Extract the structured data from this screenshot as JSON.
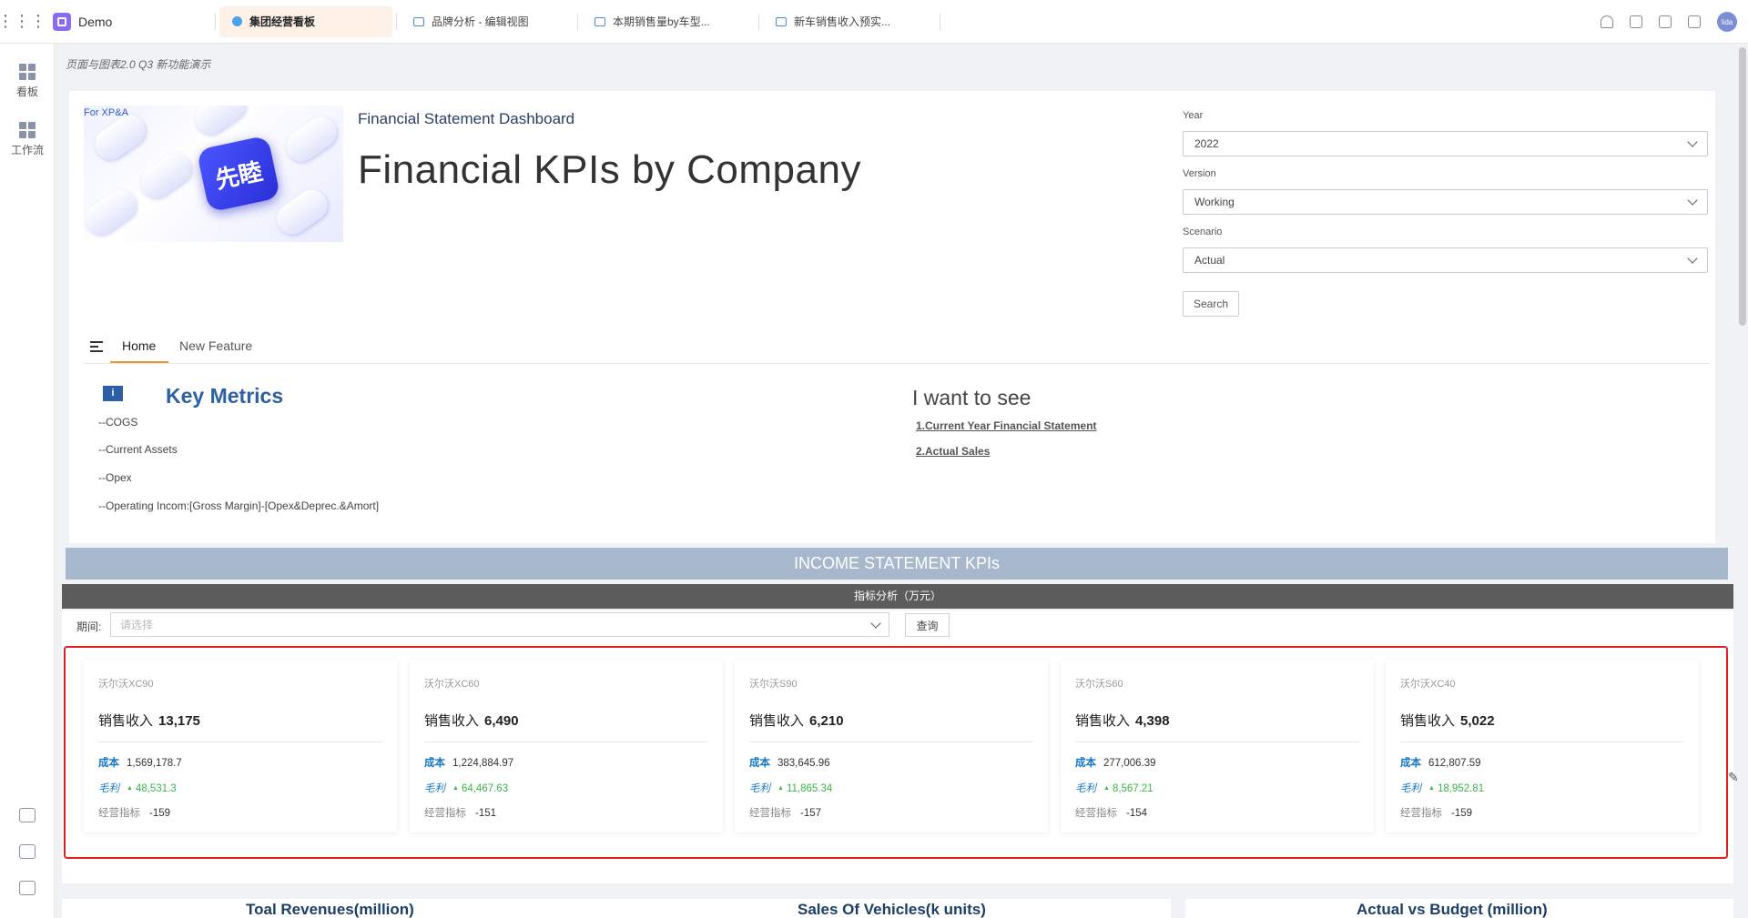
{
  "app": {
    "name": "Demo"
  },
  "tabs": [
    {
      "label": "集团经营看板",
      "active": true
    },
    {
      "label": "品牌分析 - 编辑视图",
      "active": false
    },
    {
      "label": "本期销售量by车型...",
      "active": false
    },
    {
      "label": "新车销售收入预实...",
      "active": false
    }
  ],
  "user": {
    "avatar_text": "lida"
  },
  "sidebar": {
    "items": [
      {
        "label": "看板",
        "icon": "dashboard-icon"
      },
      {
        "label": "工作流",
        "icon": "workflow-icon"
      }
    ]
  },
  "page": {
    "note": "页面与图表2.0 Q3 新功能演示",
    "hero_tag": "For XP&A",
    "hero_badge": "先睦",
    "subtitle": "Financial Statement Dashboard",
    "title": "Financial KPIs by Company"
  },
  "filters": {
    "year_label": "Year",
    "year_value": "2022",
    "version_label": "Version",
    "version_value": "Working",
    "scenario_label": "Scenario",
    "scenario_value": "Actual",
    "search_label": "Search"
  },
  "nav": {
    "home": "Home",
    "new_feature": "New Feature"
  },
  "key_metrics": {
    "icon_text": "i",
    "title": "Key Metrics",
    "items": [
      "--COGS",
      "--Current Assets",
      "--Opex",
      "--Operating Incom:[Gross Margin]-[Opex&Deprec.&Amort]"
    ]
  },
  "want": {
    "title": "I want to see",
    "links": [
      "1.Current Year Financial Statement",
      "2.Actual Sales"
    ]
  },
  "banners": {
    "income": "INCOME STATEMENT KPIs",
    "metric": "指标分析（万元）"
  },
  "period": {
    "label": "期间:",
    "placeholder": "请选择",
    "query": "查询"
  },
  "cards": [
    {
      "name": "沃尔沃XC90",
      "rev_label": "销售收入",
      "rev": "13,175",
      "cost_label": "成本",
      "cost": "1,569,178.7",
      "gp_label": "毛利",
      "gp": "48,531.3",
      "op_label": "经营指标",
      "op": "-159"
    },
    {
      "name": "沃尔沃XC60",
      "rev_label": "销售收入",
      "rev": "6,490",
      "cost_label": "成本",
      "cost": "1,224,884.97",
      "gp_label": "毛利",
      "gp": "64,467.63",
      "op_label": "经营指标",
      "op": "-151"
    },
    {
      "name": "沃尔沃S90",
      "rev_label": "销售收入",
      "rev": "6,210",
      "cost_label": "成本",
      "cost": "383,645.96",
      "gp_label": "毛利",
      "gp": "11,865.34",
      "op_label": "经营指标",
      "op": "-157"
    },
    {
      "name": "沃尔沃S60",
      "rev_label": "销售收入",
      "rev": "4,398",
      "cost_label": "成本",
      "cost": "277,006.39",
      "gp_label": "毛利",
      "gp": "8,567.21",
      "op_label": "经营指标",
      "op": "-154"
    },
    {
      "name": "沃尔沃XC40",
      "rev_label": "销售收入",
      "rev": "5,022",
      "cost_label": "成本",
      "cost": "612,807.59",
      "gp_label": "毛利",
      "gp": "18,952.81",
      "op_label": "经营指标",
      "op": "-159"
    }
  ],
  "bottom_titles": [
    "Toal Revenues(million)",
    "Sales Of Vehicles(k units)",
    "Actual vs Budget (million)"
  ]
}
